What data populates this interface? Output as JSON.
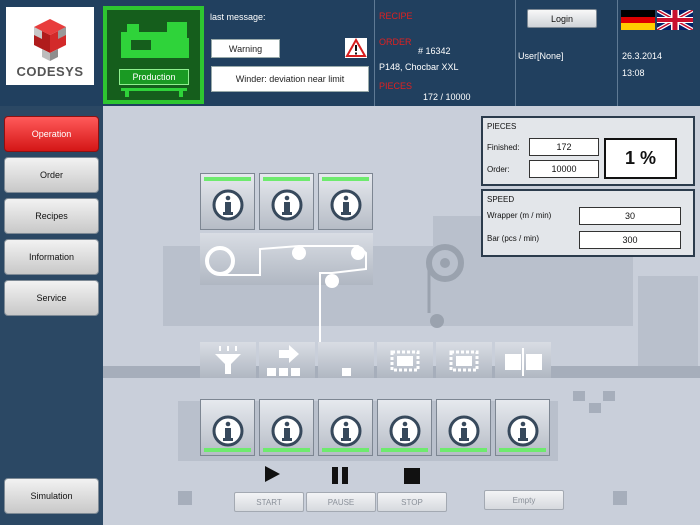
{
  "app": {
    "brand": "CODESYS"
  },
  "header": {
    "production_label": "Production",
    "last_message_label": "last message:",
    "message_type": "Warning",
    "message_text": "Winder: deviation near limit",
    "recipe_label": "RECIPE",
    "order_label": "ORDER",
    "order_number": "# 16342",
    "order_product": "P148, Chocbar XXL",
    "pieces_label": "PIECES",
    "pieces_value": "172 / 10000",
    "login_label": "Login",
    "user_text": "User[None]",
    "date": "26.3.2014",
    "time": "13:08",
    "languages": [
      "de",
      "en"
    ]
  },
  "sidebar": {
    "items": [
      {
        "label": "Operation",
        "active": true
      },
      {
        "label": "Order",
        "active": false
      },
      {
        "label": "Recipes",
        "active": false
      },
      {
        "label": "Information",
        "active": false
      },
      {
        "label": "Service",
        "active": false
      }
    ],
    "simulation_label": "Simulation"
  },
  "pieces": {
    "title": "PIECES",
    "finished_label": "Finished:",
    "finished_value": "172",
    "order_label": "Order:",
    "order_value": "10000",
    "percent": "1 %"
  },
  "speed": {
    "title": "SPEED",
    "wrapper_label": "Wrapper (m / min)",
    "wrapper_value": "30",
    "bar_label": "Bar (pcs / min)",
    "bar_value": "300"
  },
  "controls": {
    "start": "START",
    "pause": "PAUSE",
    "stop": "STOP",
    "empty": "Empty"
  },
  "colors": {
    "status_ok": "#6eea6e",
    "active_nav": "#e42a2a",
    "production_green": "#2ec630",
    "header_bg": "#21405f"
  }
}
